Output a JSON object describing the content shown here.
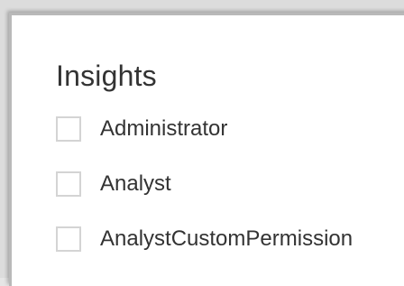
{
  "section": {
    "title": "Insights"
  },
  "options": [
    {
      "label": "Administrator",
      "checked": false
    },
    {
      "label": "Analyst",
      "checked": false
    },
    {
      "label": "AnalystCustomPermission",
      "checked": false
    }
  ]
}
